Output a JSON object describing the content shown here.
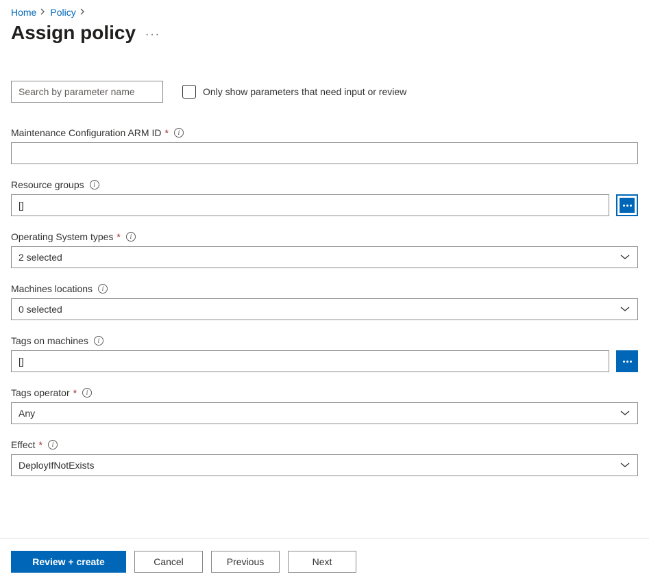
{
  "breadcrumb": {
    "home": "Home",
    "policy": "Policy"
  },
  "page": {
    "title": "Assign policy"
  },
  "filter": {
    "search_placeholder": "Search by parameter name",
    "only_show_label": "Only show parameters that need input or review"
  },
  "fields": {
    "maint_config": {
      "label": "Maintenance Configuration ARM ID",
      "value": ""
    },
    "resource_groups": {
      "label": "Resource groups",
      "value": "[]"
    },
    "os_types": {
      "label": "Operating System types",
      "value": "2 selected"
    },
    "locations": {
      "label": "Machines locations",
      "value": "0 selected"
    },
    "tags_machines": {
      "label": "Tags on machines",
      "value": "[]"
    },
    "tags_operator": {
      "label": "Tags operator",
      "value": "Any"
    },
    "effect": {
      "label": "Effect",
      "value": "DeployIfNotExists"
    }
  },
  "footer": {
    "review_create": "Review + create",
    "cancel": "Cancel",
    "previous": "Previous",
    "next": "Next"
  }
}
